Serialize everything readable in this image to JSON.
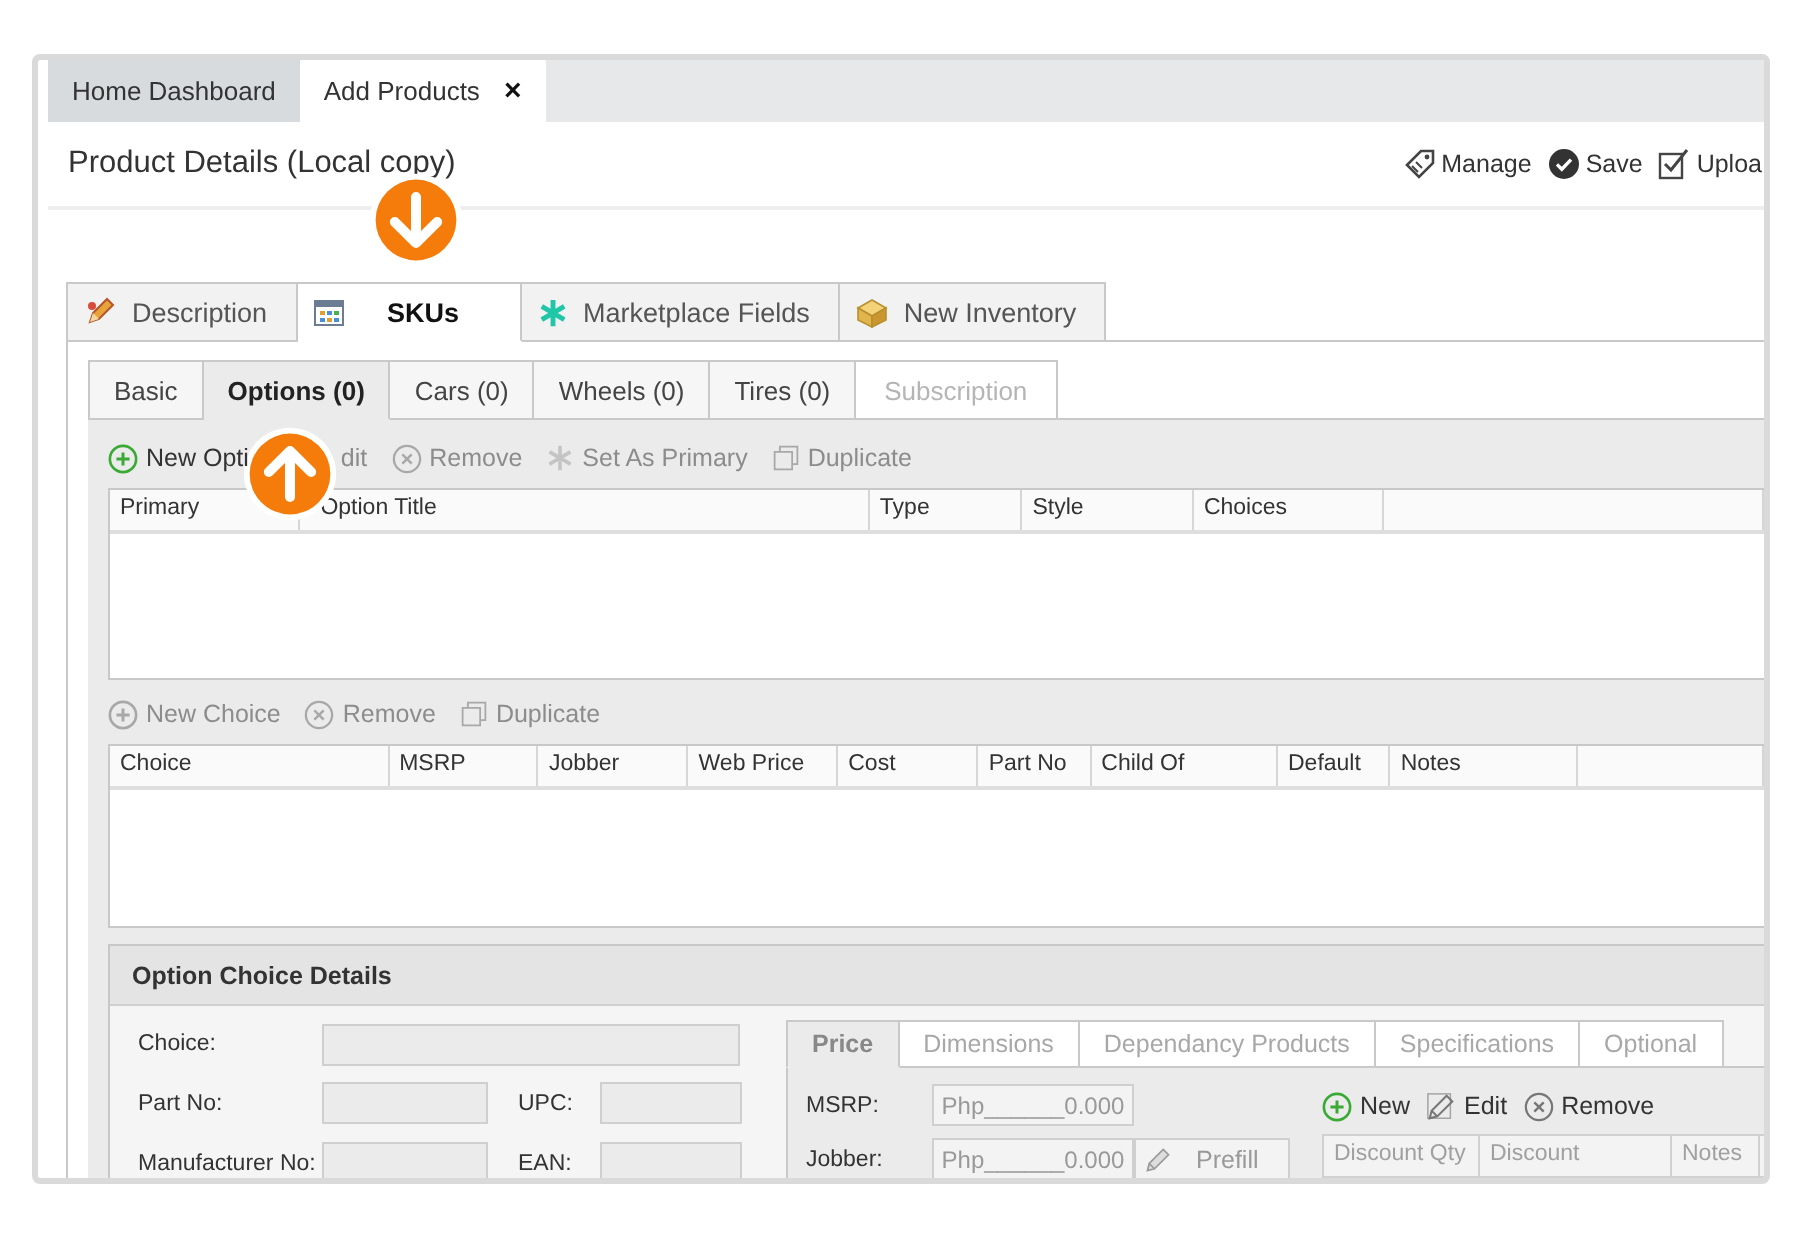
{
  "window_tabs": [
    {
      "label": "Home Dashboard",
      "selected": false
    },
    {
      "label": "Add Products",
      "selected": true,
      "close": "×"
    }
  ],
  "header": {
    "title": "Product Details (Local copy)",
    "actions": [
      {
        "label": "Manage",
        "kind": "tag"
      },
      {
        "label": "Save",
        "kind": "save"
      },
      {
        "label": "Uploa",
        "kind": "check"
      }
    ]
  },
  "main_tabs": [
    {
      "label": "Description",
      "kind": "pencil",
      "selected": false
    },
    {
      "label": "SKUs",
      "kind": "table",
      "selected": true
    },
    {
      "label": "Marketplace Fields",
      "kind": "asterisk",
      "selected": false
    },
    {
      "label": "New Inventory",
      "kind": "box",
      "selected": false
    }
  ],
  "sub_tabs": [
    {
      "label": "Basic",
      "selected": false,
      "disabled": false
    },
    {
      "label": "Options (0)",
      "selected": true,
      "disabled": false
    },
    {
      "label": "Cars (0)",
      "selected": false,
      "disabled": false
    },
    {
      "label": "Wheels (0)",
      "selected": false,
      "disabled": false
    },
    {
      "label": "Tires (0)",
      "selected": false,
      "disabled": false
    },
    {
      "label": "Subscription",
      "selected": false,
      "disabled": true
    }
  ],
  "options_toolbar": [
    {
      "label": "New Opti",
      "kind": "add",
      "disabled": false
    },
    {
      "label": "dit",
      "kind": "plain",
      "disabled": true
    },
    {
      "label": "Remove",
      "kind": "remove",
      "disabled": true
    },
    {
      "label": "Set As Primary",
      "kind": "primary",
      "disabled": true
    },
    {
      "label": "Duplicate",
      "kind": "duplicate",
      "disabled": true
    }
  ],
  "options_grid": {
    "columns": [
      "Primary",
      "Option Title",
      "Type",
      "Style",
      "Choices"
    ]
  },
  "choices_toolbar": [
    {
      "label": "New Choice",
      "kind": "add",
      "disabled": true
    },
    {
      "label": "Remove",
      "kind": "remove",
      "disabled": true
    },
    {
      "label": "Duplicate",
      "kind": "duplicate",
      "disabled": true
    }
  ],
  "choices_grid": {
    "columns": [
      "Choice",
      "MSRP",
      "Jobber",
      "Web Price",
      "Cost",
      "Part No",
      "Child Of",
      "Default",
      "Notes"
    ]
  },
  "option_choice_details": {
    "title": "Option Choice Details",
    "fields": [
      {
        "label": "Choice:",
        "kind": "wide"
      },
      {
        "label": "Part No:",
        "kind": "pair"
      },
      {
        "label": "UPC:",
        "kind": "pair"
      },
      {
        "label": "Manufacturer No:",
        "kind": "pair"
      },
      {
        "label": "EAN:",
        "kind": "pair"
      }
    ],
    "tabs": [
      {
        "label": "Price",
        "selected": true
      },
      {
        "label": "Dimensions",
        "selected": false
      },
      {
        "label": "Dependancy Products",
        "selected": false
      },
      {
        "label": "Specifications",
        "selected": false
      },
      {
        "label": "Optional",
        "selected": false
      }
    ],
    "price": {
      "rows": [
        {
          "label": "MSRP:",
          "value": "Php______0.000"
        },
        {
          "label": "Jobber:",
          "value": "Php______0.000",
          "button": "Prefill"
        }
      ],
      "toolbar": [
        {
          "label": "New",
          "kind": "add",
          "disabled": false
        },
        {
          "label": "Edit",
          "kind": "edit",
          "disabled": false
        },
        {
          "label": "Remove",
          "kind": "remove",
          "disabled": false
        }
      ],
      "discount_columns": [
        "Discount Qty",
        "Discount",
        "Notes"
      ]
    }
  }
}
